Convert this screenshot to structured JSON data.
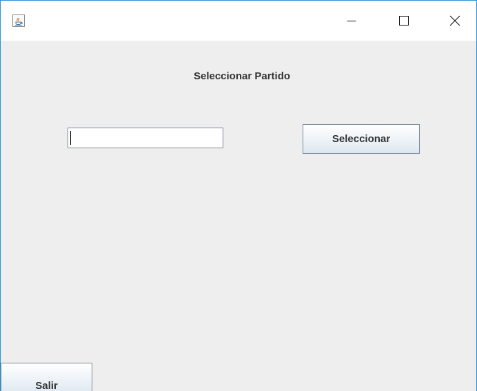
{
  "window": {
    "app_icon": "java-cup-icon",
    "controls": {
      "minimize": "minimize-icon",
      "maximize": "maximize-icon",
      "close": "close-icon"
    }
  },
  "main": {
    "heading": "Seleccionar Partido",
    "input_value": "",
    "select_button": "Seleccionar",
    "exit_button": "Salir"
  },
  "colors": {
    "window_border": "#2b8fd6",
    "content_background": "#eeeeee",
    "text": "#333333"
  }
}
